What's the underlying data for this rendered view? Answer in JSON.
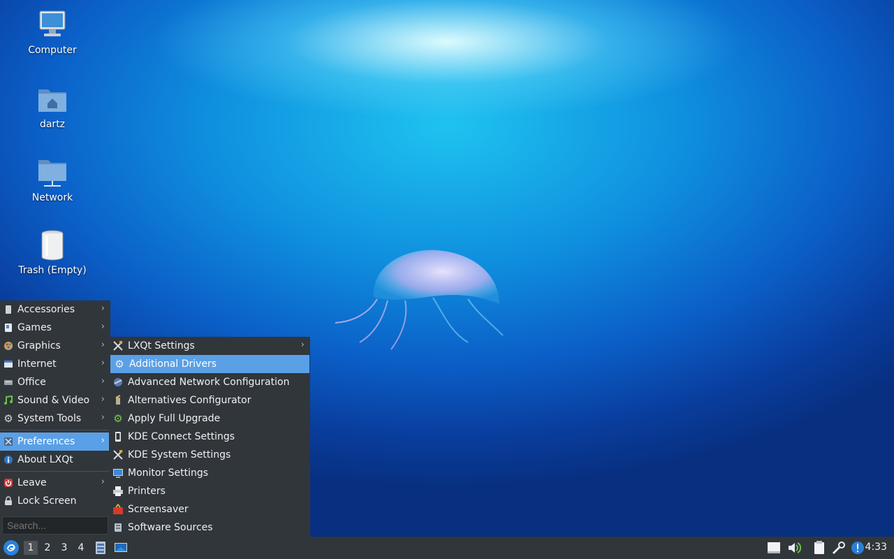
{
  "desktop": {
    "icons": [
      {
        "label": "Computer"
      },
      {
        "label": "dartz"
      },
      {
        "label": "Network"
      },
      {
        "label": "Trash (Empty)"
      }
    ]
  },
  "menu": {
    "items": [
      {
        "label": "Accessories",
        "icon": "accessories-icon",
        "has_submenu": true
      },
      {
        "label": "Games",
        "icon": "games-icon",
        "has_submenu": true
      },
      {
        "label": "Graphics",
        "icon": "graphics-icon",
        "has_submenu": true
      },
      {
        "label": "Internet",
        "icon": "internet-icon",
        "has_submenu": true
      },
      {
        "label": "Office",
        "icon": "office-icon",
        "has_submenu": true
      },
      {
        "label": "Sound & Video",
        "icon": "sound-video-icon",
        "has_submenu": true
      },
      {
        "label": "System Tools",
        "icon": "gear-icon",
        "has_submenu": true
      },
      {
        "label": "Preferences",
        "icon": "preferences-icon",
        "has_submenu": true,
        "active": true
      },
      {
        "label": "About LXQt",
        "icon": "info-icon",
        "has_submenu": false
      },
      {
        "label": "Leave",
        "icon": "power-icon",
        "has_submenu": true
      },
      {
        "label": "Lock Screen",
        "icon": "lock-icon",
        "has_submenu": false
      }
    ],
    "search_placeholder": "Search..."
  },
  "submenu": {
    "items": [
      {
        "label": "LXQt Settings",
        "icon": "tools-icon",
        "has_submenu": true
      },
      {
        "label": "Additional Drivers",
        "icon": "driver-gear-icon",
        "active": true
      },
      {
        "label": "Advanced Network Configuration",
        "icon": "network-config-icon"
      },
      {
        "label": "Alternatives Configurator",
        "icon": "configurator-icon"
      },
      {
        "label": "Apply Full Upgrade",
        "icon": "upgrade-gear-icon"
      },
      {
        "label": "KDE Connect Settings",
        "icon": "phone-icon"
      },
      {
        "label": "KDE System Settings",
        "icon": "tools-icon"
      },
      {
        "label": "Monitor Settings",
        "icon": "monitor-icon"
      },
      {
        "label": "Printers",
        "icon": "printer-icon"
      },
      {
        "label": "Screensaver",
        "icon": "screensaver-icon"
      },
      {
        "label": "Software Sources",
        "icon": "software-sources-icon"
      }
    ]
  },
  "taskbar": {
    "workspaces": [
      "1",
      "2",
      "3",
      "4"
    ],
    "active_workspace": "1",
    "clock": "4:33"
  },
  "colors": {
    "panel": "#31363b",
    "highlight": "#5aa0e6"
  }
}
